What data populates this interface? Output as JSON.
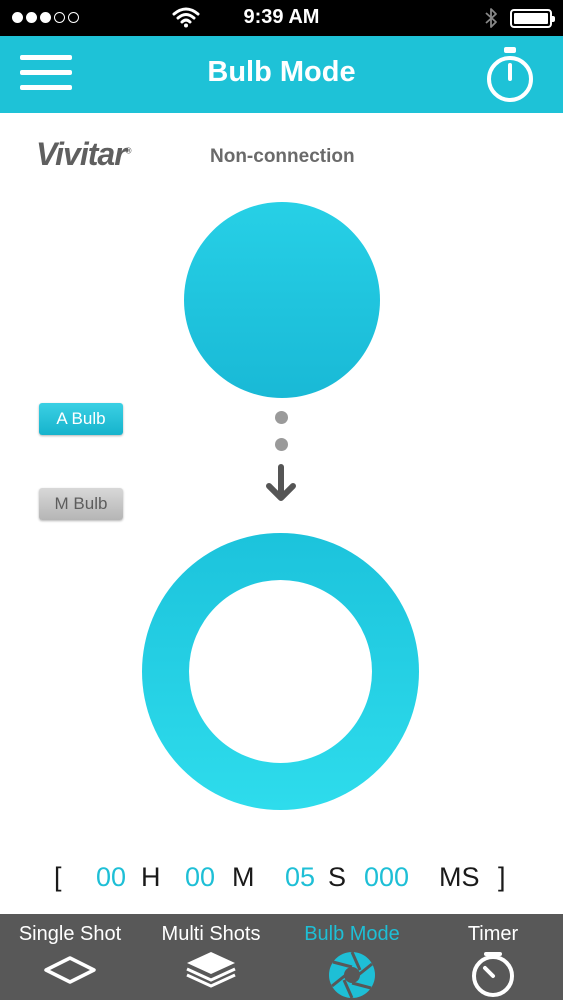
{
  "status_bar": {
    "time": "9:39 AM"
  },
  "header": {
    "title": "Bulb Mode"
  },
  "brand": {
    "logo_text": "Vivitar"
  },
  "connection": {
    "status": "Non-connection"
  },
  "modes": {
    "a_bulb": "A Bulb",
    "m_bulb": "M Bulb"
  },
  "timer": {
    "open_bracket": "[",
    "hours": "00",
    "hours_unit": "H",
    "minutes": "00",
    "minutes_unit": "M",
    "seconds": "05",
    "seconds_unit": "S",
    "milliseconds": "000",
    "milliseconds_unit": "MS",
    "close_bracket": "]"
  },
  "tabs": [
    {
      "label": "Single Shot",
      "icon": "diamond-icon"
    },
    {
      "label": "Multi Shots",
      "icon": "layers-icon"
    },
    {
      "label": "Bulb Mode",
      "icon": "aperture-icon"
    },
    {
      "label": "Timer",
      "icon": "timer-icon"
    }
  ],
  "colors": {
    "accent": "#1ec2d7",
    "tab_bar": "#585858",
    "inactive_button": "#c4c4c4"
  }
}
